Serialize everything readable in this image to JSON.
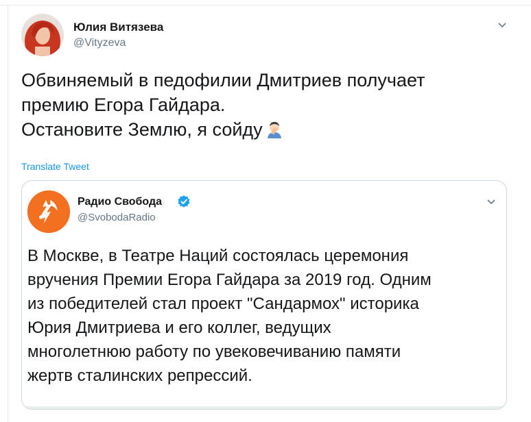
{
  "tweet": {
    "author_name": "Юлия Витязева",
    "author_handle": "@Vityzeva",
    "text_lines": [
      "Обвиняемый в педофилии Дмитриев получает",
      "премию Егора Гайдара.",
      "Остановите Землю, я сойду"
    ],
    "emoji": "man-facepalming-emoji",
    "translate_label": "Translate Tweet"
  },
  "quoted_tweet": {
    "author_name": "Радио Свобода",
    "author_handle": "@SvobodaRadio",
    "verified": true,
    "text_lines": [
      "В Москве, в Театре Наций состоялась церемония",
      "вручения Премии Егора Гайдара за 2019 год. Одним",
      "из победителей стал проект \"Сандармох\" историка",
      "Юрия Дмитриева и его коллег, ведущих",
      "многолетнюю работу по увековечиванию памяти",
      "жертв сталинских репрессий."
    ]
  },
  "colors": {
    "text": "#14171a",
    "secondary": "#657786",
    "link": "#1b95e0",
    "border": "#ccd6dd",
    "brand_orange": "#f37021",
    "verified_blue": "#1da1f2"
  }
}
